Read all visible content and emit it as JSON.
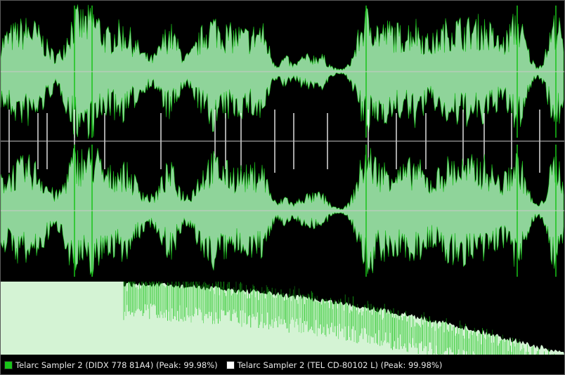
{
  "colors": {
    "background": "#000000",
    "track_a": "#19c419",
    "track_b": "#ffffff",
    "overlap": "#8fd49a",
    "spectrum_fill": "#d4f3d4",
    "center_line": "#c8c8c8",
    "marker": "#ffffff"
  },
  "legend": [
    {
      "icon": "green-square-swatch",
      "color": "#19c419",
      "label": "Telarc Sampler 2 (DIDX 778 81A4) (Peak: 99.98%)"
    },
    {
      "icon": "white-square-swatch",
      "color": "#ffffff",
      "label": "Telarc Sampler 2 (TEL CD-80102 L) (Peak: 99.98%)"
    }
  ]
}
